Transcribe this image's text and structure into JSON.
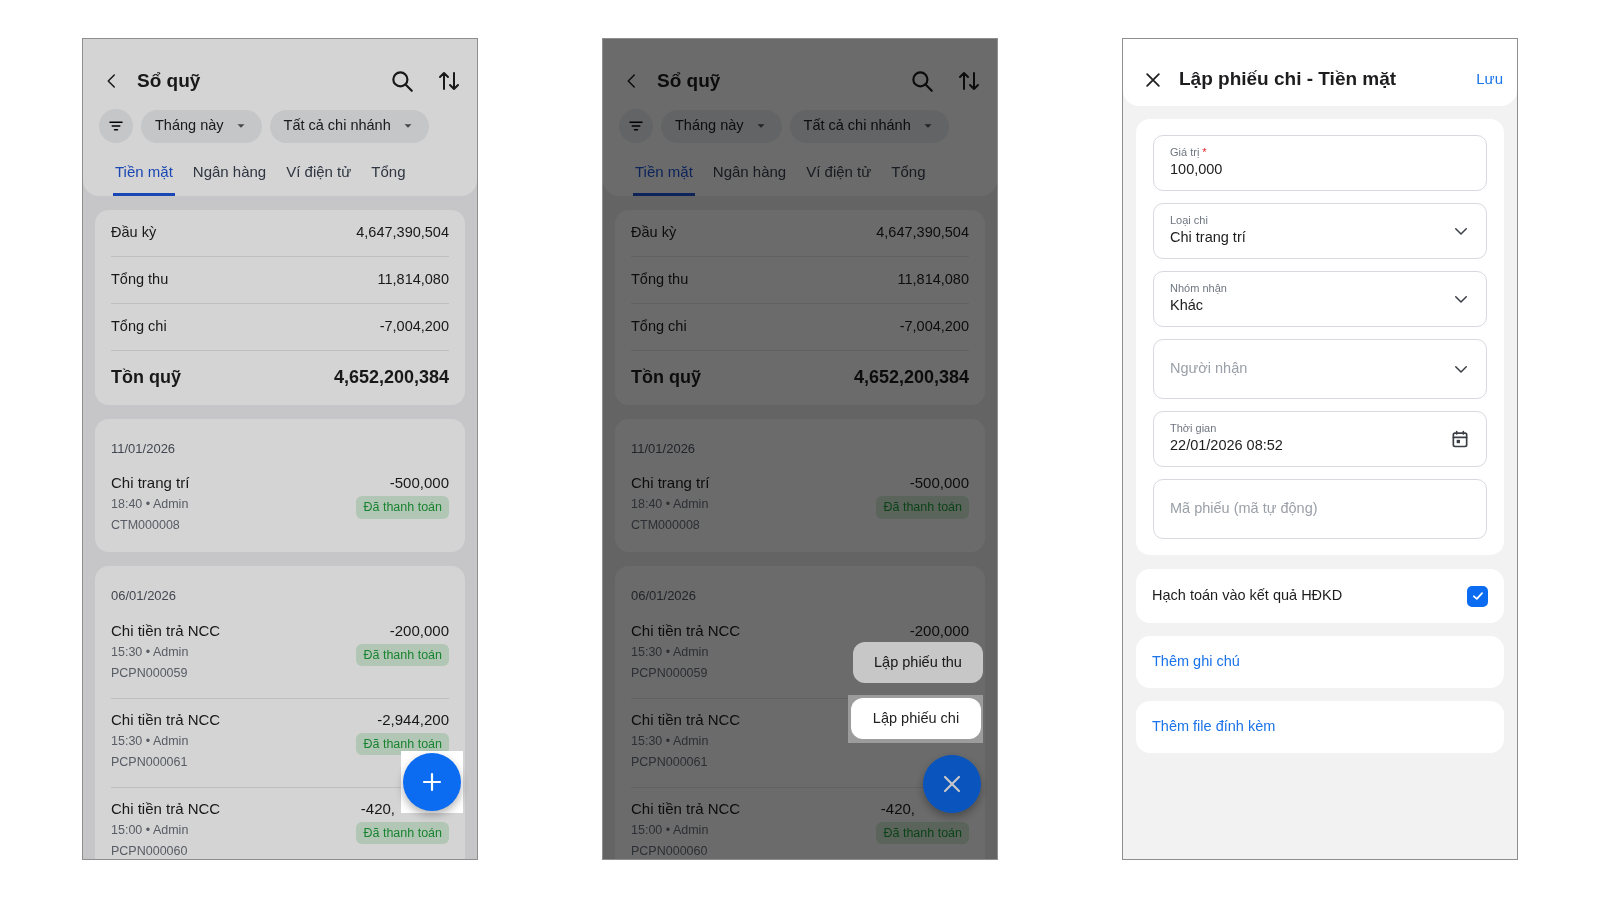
{
  "screens": [
    {
      "kind": "ledger",
      "title": "Sổ quỹ",
      "filters": [
        "Tháng này",
        "Tất cả chi nhánh"
      ],
      "tabs": [
        {
          "label": "Tiền mặt",
          "selected": true
        },
        {
          "label": "Ngân hàng",
          "selected": false
        },
        {
          "label": "Ví điện tử",
          "selected": false
        },
        {
          "label": "Tổng",
          "selected": false
        }
      ],
      "summary": [
        {
          "kind": "row",
          "label": "Đầu kỳ",
          "value": "4,647,390,504"
        },
        {
          "kind": "row",
          "label": "Tổng thu",
          "value": "11,814,080"
        },
        {
          "kind": "row",
          "label": "Tổng chi",
          "value": "-7,004,200"
        },
        {
          "kind": "total",
          "label": "Tồn quỹ",
          "value": "4,652,200,384"
        }
      ],
      "groups": [
        {
          "date": "11/01/2026",
          "entries": [
            {
              "title": "Chi trang trí",
              "meta": "18:40 • Admin",
              "code": "CTM000008",
              "amount": "-500,000",
              "status": "Đã thanh toán"
            }
          ]
        },
        {
          "date": "06/01/2026",
          "entries": [
            {
              "title": "Chi tiền trả NCC",
              "meta": "15:30 • Admin",
              "code": "PCPN000059",
              "amount": "-200,000",
              "status": "Đã thanh toán"
            },
            {
              "title": "Chi tiền trả NCC",
              "meta": "15:30 • Admin",
              "code": "PCPN000061",
              "amount": "-2,944,200",
              "status": "Đã thanh toán"
            },
            {
              "title": "Chi tiền trả NCC",
              "meta": "15:00 • Admin",
              "code": "PCPN000060",
              "amount": "-420,",
              "amount_cut": true,
              "status": "Đã thanh toán"
            }
          ]
        }
      ],
      "fab": {
        "expanded": false,
        "spotlight": true
      }
    },
    {
      "kind": "ledger",
      "title": "Sổ quỹ",
      "filters": [
        "Tháng này",
        "Tất cả chi nhánh"
      ],
      "tabs": [
        {
          "label": "Tiền mặt",
          "selected": true
        },
        {
          "label": "Ngân hàng",
          "selected": false
        },
        {
          "label": "Ví điện tử",
          "selected": false
        },
        {
          "label": "Tổng",
          "selected": false
        }
      ],
      "summary": [
        {
          "kind": "row",
          "label": "Đầu kỳ",
          "value": "4,647,390,504"
        },
        {
          "kind": "row",
          "label": "Tổng thu",
          "value": "11,814,080"
        },
        {
          "kind": "row",
          "label": "Tổng chi",
          "value": "-7,004,200"
        },
        {
          "kind": "total",
          "label": "Tồn quỹ",
          "value": "4,652,200,384"
        }
      ],
      "groups": [
        {
          "date": "11/01/2026",
          "entries": [
            {
              "title": "Chi trang trí",
              "meta": "18:40 • Admin",
              "code": "CTM000008",
              "amount": "-500,000",
              "status": "Đã thanh toán"
            }
          ]
        },
        {
          "date": "06/01/2026",
          "entries": [
            {
              "title": "Chi tiền trả NCC",
              "meta": "15:30 • Admin",
              "code": "PCPN000059",
              "amount": "-200,000"
            },
            {
              "title": "Chi tiền trả NCC",
              "meta": "15:30 • Admin",
              "code": "PCPN000061"
            },
            {
              "title": "Chi tiền trả NCC",
              "meta": "15:00 • Admin",
              "code": "PCPN000060",
              "amount": "-420,",
              "amount_cut": true,
              "status": "Đã thanh toán"
            }
          ]
        }
      ],
      "menu": [
        {
          "label": "Lập phiếu thu",
          "spotlight": false
        },
        {
          "label": "Lập phiếu chi",
          "spotlight": true
        }
      ],
      "fab": {
        "expanded": true,
        "spotlight": false
      }
    },
    {
      "kind": "form",
      "title": "Lập phiếu chi - Tiền mặt",
      "save": "Lưu",
      "fields": [
        {
          "kind": "text",
          "label": "Giá trị",
          "required_mark": "*",
          "value": "100,000"
        },
        {
          "kind": "select",
          "label": "Loại chi",
          "value": "Chi trang trí"
        },
        {
          "kind": "select",
          "label": "Nhóm nhận",
          "value": "Khác"
        },
        {
          "kind": "select",
          "placeholder": "Người nhận"
        },
        {
          "kind": "date",
          "label": "Thời gian",
          "value": "22/01/2026 08:52"
        },
        {
          "kind": "text",
          "placeholder": "Mã phiếu (mã tự động)"
        }
      ],
      "option": {
        "label": "Hạch toán vào kết quả HĐKD",
        "checked": true
      },
      "actions": [
        "Thêm ghi chú",
        "Thêm file đính kèm"
      ]
    }
  ]
}
